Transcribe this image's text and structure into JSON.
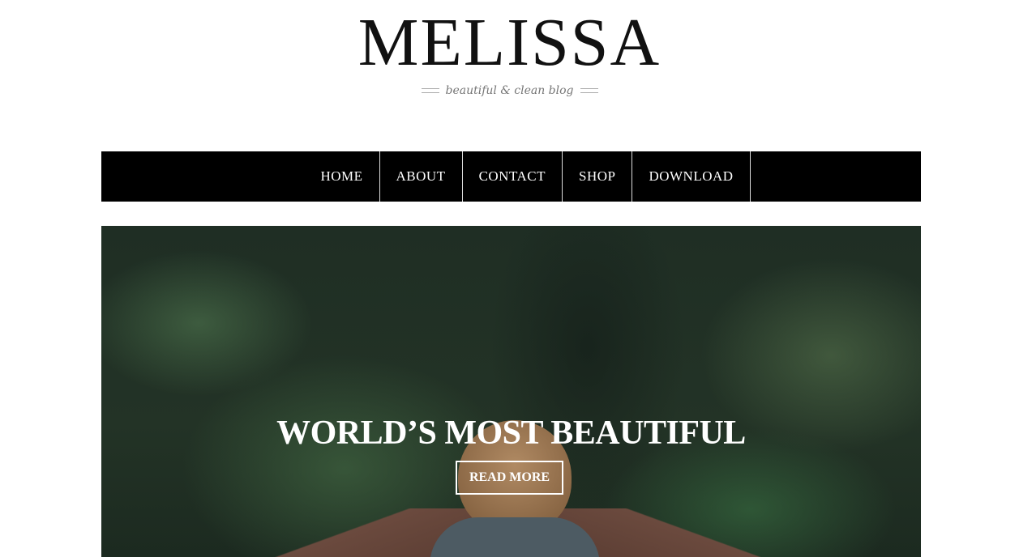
{
  "header": {
    "title": "MELISSA",
    "tagline": "beautiful & clean blog"
  },
  "nav": {
    "items": [
      {
        "label": "HOME"
      },
      {
        "label": "ABOUT"
      },
      {
        "label": "CONTACT"
      },
      {
        "label": "SHOP"
      },
      {
        "label": "DOWNLOAD"
      }
    ]
  },
  "hero": {
    "title": "WORLD’S MOST BEAUTIFUL",
    "button": "READ MORE"
  }
}
